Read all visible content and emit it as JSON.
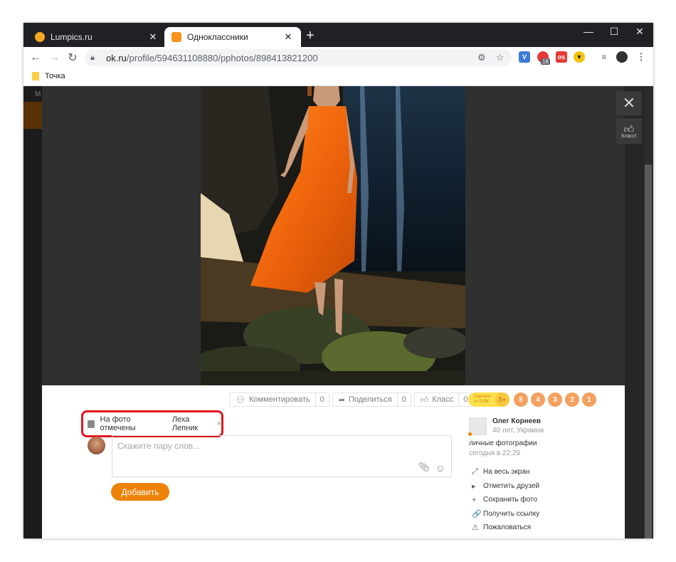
{
  "browser": {
    "tabs": [
      {
        "title": "Lumpics.ru",
        "close": "✕",
        "active": false
      },
      {
        "title": "Одноклассники",
        "close": "✕",
        "active": true
      }
    ],
    "new_tab": "+",
    "window_controls": {
      "minimize": "—",
      "maximize": "☐",
      "close": "✕"
    },
    "url_host": "ok.ru",
    "url_path": "/profile/594631108880/pphotos/898413821200",
    "extension_badge": "18",
    "bookmark": "Точка"
  },
  "background": {
    "letter": "М"
  },
  "viewer": {
    "close": "✕",
    "klass_label": "Класс!",
    "actions": [
      {
        "icon": "speech-icon",
        "glyph": "💬",
        "label": "Комментировать",
        "count": "0"
      },
      {
        "icon": "share-icon",
        "glyph": "➦",
        "label": "Поделиться",
        "count": "0"
      },
      {
        "icon": "like-icon",
        "glyph": "👍",
        "label": "Класс",
        "count": "0"
      }
    ],
    "tagged_label": "На фото отмечены",
    "tagged_person": "Леха Лепник",
    "tagged_remove": "×",
    "comment_placeholder": "Скажите пару слов...",
    "add_button": "Добавить",
    "rate_text": "Оценить от 0 ОК",
    "rate_plus": "5+",
    "ratings": [
      "5",
      "4",
      "3",
      "2",
      "1"
    ],
    "owner_name": "Олег Корнеев",
    "owner_meta": "40 лет, Украина",
    "album": "личные фотографии",
    "timestamp": "сегодня в 22:29",
    "side_links": [
      {
        "icon": "expand-icon",
        "glyph": "⤢",
        "label": "На весь экран"
      },
      {
        "icon": "tag-friends-icon",
        "glyph": "▸",
        "label": "Отметить друзей"
      },
      {
        "icon": "plus-icon",
        "glyph": "+",
        "label": "Сохранить фото"
      },
      {
        "icon": "link-icon",
        "glyph": "🔗",
        "label": "Получить ссылку"
      },
      {
        "icon": "warning-icon",
        "glyph": "⚠",
        "label": "Пожаловаться"
      }
    ]
  },
  "colors": {
    "accent": "#ee8208",
    "highlight": "#e0161e",
    "rating": "#f4a15f"
  }
}
